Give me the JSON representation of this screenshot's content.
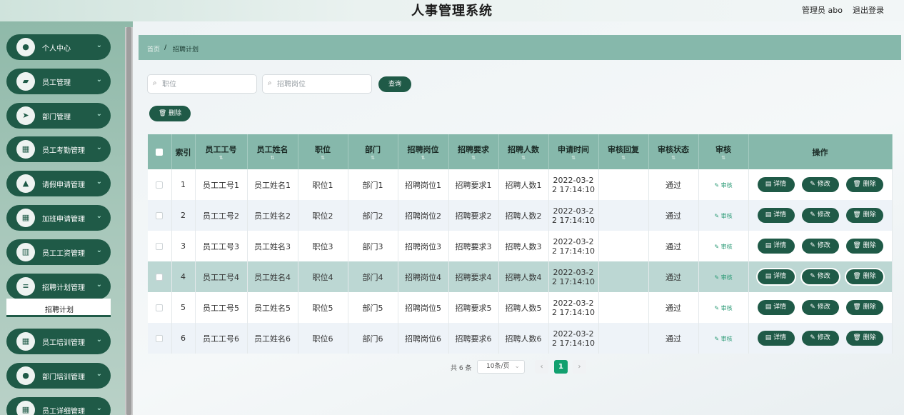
{
  "header": {
    "title": "人事管理系统",
    "user_label": "管理员 abo",
    "logout_label": "退出登录"
  },
  "sidebar": {
    "items": [
      {
        "label": "个人中心",
        "icon": "person-icon",
        "glyph": "●"
      },
      {
        "label": "员工管理",
        "icon": "briefcase-icon",
        "glyph": "▰"
      },
      {
        "label": "部门管理",
        "icon": "send-icon",
        "glyph": "➤"
      },
      {
        "label": "员工考勤管理",
        "icon": "grid-icon",
        "glyph": "▦"
      },
      {
        "label": "请假申请管理",
        "icon": "person-upload-icon",
        "glyph": "▲"
      },
      {
        "label": "加班申请管理",
        "icon": "grid-icon",
        "glyph": "▦"
      },
      {
        "label": "员工工资管理",
        "icon": "bar-chart-icon",
        "glyph": "▥"
      },
      {
        "label": "招聘计划管理",
        "icon": "menu-icon",
        "glyph": "≡"
      },
      {
        "label": "员工培训管理",
        "icon": "grid-icon",
        "glyph": "▦"
      },
      {
        "label": "部门培训管理",
        "icon": "person-icon",
        "glyph": "●"
      },
      {
        "label": "员工详细管理",
        "icon": "grid-icon",
        "glyph": "▦"
      }
    ],
    "submenu_label": "招聘计划"
  },
  "breadcrumb": {
    "home": "首页",
    "separator": "/",
    "current": "招聘计划"
  },
  "search": {
    "field1_placeholder": "职位",
    "field2_placeholder": "招聘岗位",
    "button_label": "查询"
  },
  "actions": {
    "delete_label": "删除"
  },
  "table": {
    "headers": [
      "索引",
      "员工工号",
      "员工姓名",
      "职位",
      "部门",
      "招聘岗位",
      "招聘要求",
      "招聘人数",
      "申请时间",
      "审核回复",
      "审核状态",
      "审核",
      "操作"
    ],
    "rows": [
      {
        "index": "1",
        "emp_no": "员工工号1",
        "emp_name": "员工姓名1",
        "position": "职位1",
        "dept": "部门1",
        "post": "招聘岗位1",
        "req": "招聘要求1",
        "count": "招聘人数1",
        "time_a": "2022-03-2",
        "time_b": "2 17:14:10",
        "reply": "",
        "status": "通过"
      },
      {
        "index": "2",
        "emp_no": "员工工号2",
        "emp_name": "员工姓名2",
        "position": "职位2",
        "dept": "部门2",
        "post": "招聘岗位2",
        "req": "招聘要求2",
        "count": "招聘人数2",
        "time_a": "2022-03-2",
        "time_b": "2 17:14:10",
        "reply": "",
        "status": "通过"
      },
      {
        "index": "3",
        "emp_no": "员工工号3",
        "emp_name": "员工姓名3",
        "position": "职位3",
        "dept": "部门3",
        "post": "招聘岗位3",
        "req": "招聘要求3",
        "count": "招聘人数3",
        "time_a": "2022-03-2",
        "time_b": "2 17:14:10",
        "reply": "",
        "status": "通过"
      },
      {
        "index": "4",
        "emp_no": "员工工号4",
        "emp_name": "员工姓名4",
        "position": "职位4",
        "dept": "部门4",
        "post": "招聘岗位4",
        "req": "招聘要求4",
        "count": "招聘人数4",
        "time_a": "2022-03-2",
        "time_b": "2 17:14:10",
        "reply": "",
        "status": "通过"
      },
      {
        "index": "5",
        "emp_no": "员工工号5",
        "emp_name": "员工姓名5",
        "position": "职位5",
        "dept": "部门5",
        "post": "招聘岗位5",
        "req": "招聘要求5",
        "count": "招聘人数5",
        "time_a": "2022-03-2",
        "time_b": "2 17:14:10",
        "reply": "",
        "status": "通过"
      },
      {
        "index": "6",
        "emp_no": "员工工号6",
        "emp_name": "员工姓名6",
        "position": "职位6",
        "dept": "部门6",
        "post": "招聘岗位6",
        "req": "招聘要求6",
        "count": "招聘人数6",
        "time_a": "2022-03-2",
        "time_b": "2 17:14:10",
        "reply": "",
        "status": "通过"
      }
    ],
    "audit_label": "审核",
    "op_detail": "详情",
    "op_edit": "修改",
    "op_delete": "删除"
  },
  "pagination": {
    "total": "共 6 条",
    "page_size": "10条/页",
    "prev": "‹",
    "next": "›",
    "current_page": "1"
  },
  "colors": {
    "primary": "#1f5a47",
    "header_row": "#86b8ab",
    "active_page": "#12a06f",
    "audit_link": "#2a9a75"
  }
}
